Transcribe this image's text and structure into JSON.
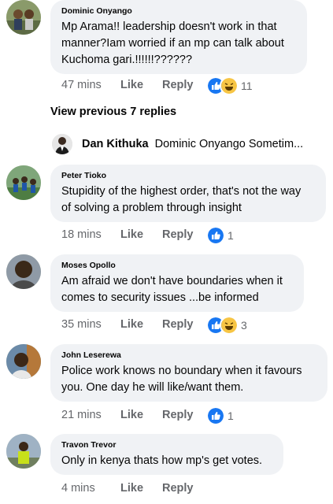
{
  "comments": [
    {
      "author": "Dominic Onyango",
      "text_lines": [
        "Mp Arama!! leadership doesn't work  in that",
        "manner?Iam worried if an mp can talk about",
        "Kuchoma gari.!!!!!!??????"
      ],
      "time": "47 mins",
      "like": "Like",
      "reply": "Reply",
      "reactions": [
        "like",
        "haha"
      ],
      "reaction_count": "11"
    },
    {
      "author": "Peter Tioko",
      "text_lines": [
        "Stupidity of the highest order, that's not the way",
        "of solving a problem through insight"
      ],
      "time": "18 mins",
      "like": "Like",
      "reply": "Reply",
      "reactions": [
        "like"
      ],
      "reaction_count": "1"
    },
    {
      "author": "Moses Opollo",
      "text_lines": [
        "Am afraid we don't have boundaries when it",
        "comes to security issues ...be informed"
      ],
      "time": "35 mins",
      "like": "Like",
      "reply": "Reply",
      "reactions": [
        "like",
        "haha"
      ],
      "reaction_count": "3"
    },
    {
      "author": "John Leserewa",
      "text_lines": [
        "Police work knows no boundary when it favours",
        "you. One day he will like/want them."
      ],
      "time": "21 mins",
      "like": "Like",
      "reply": "Reply",
      "reactions": [
        "like"
      ],
      "reaction_count": "1"
    },
    {
      "author": "Travon Trevor",
      "text_lines": [
        "Only in kenya thats how mp's get votes."
      ],
      "time": "4 mins",
      "like": "Like",
      "reply": "Reply"
    }
  ],
  "view_previous": "View previous 7 replies",
  "reply_preview": {
    "author": "Dan Kithuka",
    "text": "Dominic Onyango Sometim..."
  },
  "colors": {
    "bubble": "#f0f2f5",
    "meta": "#65676b",
    "like_blue": "#1877f2",
    "haha_yellow": "#f7c544"
  }
}
